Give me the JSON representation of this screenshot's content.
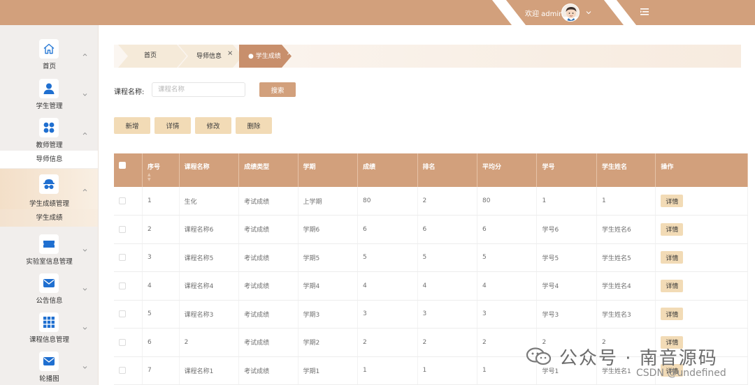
{
  "header": {
    "welcome": "欢迎 admin",
    "accent_color": "#d2a07c"
  },
  "sidebar": {
    "items": [
      {
        "label": "首页",
        "icon": "home-icon"
      },
      {
        "label": "学生管理",
        "icon": "user-icon"
      },
      {
        "label": "教师管理",
        "icon": "grid-dots-icon",
        "sub": "导师信息"
      },
      {
        "label": "学生成绩管理",
        "icon": "mask-icon",
        "sub": "学生成绩"
      },
      {
        "label": "实验室信息管理",
        "icon": "ticket-icon"
      },
      {
        "label": "公告信息",
        "icon": "mail-icon"
      },
      {
        "label": "课程信息管理",
        "icon": "apps-icon"
      },
      {
        "label": "轮播图",
        "icon": "mail-icon"
      }
    ]
  },
  "breadcrumb": {
    "items": [
      {
        "label": "首页"
      },
      {
        "label": "导师信息",
        "close": "×"
      },
      {
        "label": "● 学生成绩",
        "close": "×"
      }
    ]
  },
  "search": {
    "label": "课程名称:",
    "placeholder": "课程名称",
    "button": "搜索"
  },
  "actions": {
    "add": "新增",
    "detail": "详情",
    "edit": "修改",
    "delete": "删除"
  },
  "table": {
    "columns": [
      "序号",
      "课程名称",
      "成绩类型",
      "学期",
      "成绩",
      "排名",
      "平均分",
      "学号",
      "学生姓名",
      "操作"
    ],
    "action_label": "详情",
    "rows": [
      [
        "1",
        "生化",
        "考试成绩",
        "上学期",
        "80",
        "2",
        "80",
        "1",
        "1"
      ],
      [
        "2",
        "课程名称6",
        "考试成绩",
        "学期6",
        "6",
        "6",
        "6",
        "学号6",
        "学生姓名6"
      ],
      [
        "3",
        "课程名称5",
        "考试成绩",
        "学期5",
        "5",
        "5",
        "5",
        "学号5",
        "学生姓名5"
      ],
      [
        "4",
        "课程名称4",
        "考试成绩",
        "学期4",
        "4",
        "4",
        "4",
        "学号4",
        "学生姓名4"
      ],
      [
        "5",
        "课程名称3",
        "考试成绩",
        "学期3",
        "3",
        "3",
        "3",
        "学号3",
        "学生姓名3"
      ],
      [
        "6",
        "2",
        "考试成绩",
        "学期2",
        "2",
        "2",
        "2",
        "2",
        "2"
      ],
      [
        "7",
        "课程名称1",
        "考试成绩",
        "学期1",
        "1",
        "1",
        "1",
        "学号1",
        "学生姓名1"
      ]
    ]
  },
  "watermark": {
    "text": "公众号 · 南音源码",
    "csdn": "CSDN @undefined"
  }
}
